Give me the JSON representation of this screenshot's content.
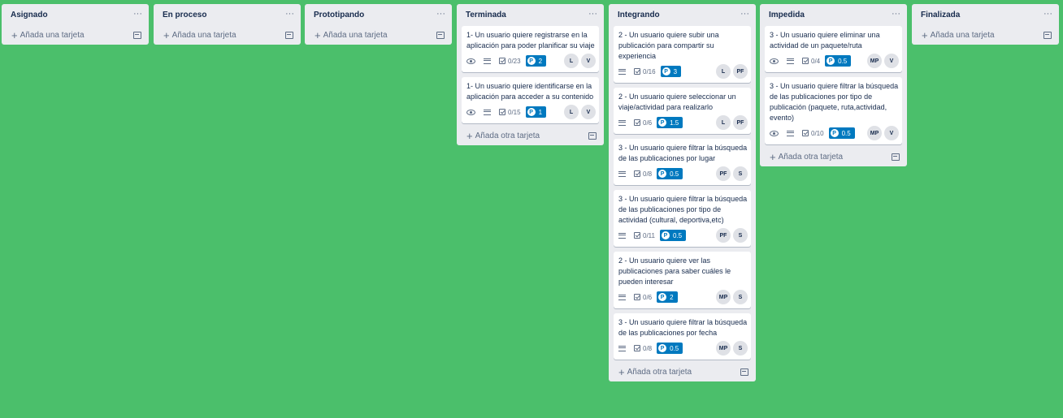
{
  "common": {
    "add_card": "Añada una tarjeta",
    "add_other_card": "Añada otra tarjeta",
    "menu": "···"
  },
  "colors": {
    "background": "#4bbf6b",
    "list": "#ebecf0",
    "points_badge": "#0079bf"
  },
  "lists": [
    {
      "title": "Asignado",
      "cards": []
    },
    {
      "title": "En proceso",
      "cards": []
    },
    {
      "title": "Prototipando",
      "cards": []
    },
    {
      "title": "Terminada",
      "cards": [
        {
          "text": "1- Un usuario quiere registrarse en la aplicación para poder planificar su viaje",
          "watch": true,
          "description": true,
          "checklist": "0/23",
          "points": "2",
          "members": [
            "L",
            "V"
          ]
        },
        {
          "text": "1- Un usuario quiere identificarse en la aplicación para acceder a su contenido",
          "watch": true,
          "description": true,
          "checklist": "0/15",
          "points": "1",
          "members": [
            "L",
            "V"
          ]
        }
      ]
    },
    {
      "title": "Integrando",
      "cards": [
        {
          "text": "2 - Un usuario quiere subir una publicación para compartir su experiencia",
          "watch": false,
          "description": true,
          "checklist": "0/16",
          "points": "3",
          "members": [
            "L",
            "PF"
          ]
        },
        {
          "text": "2 - Un usuario quiere seleccionar un viaje/actividad para realizarlo",
          "watch": false,
          "description": true,
          "checklist": "0/6",
          "points": "1.5",
          "members": [
            "L",
            "PF"
          ]
        },
        {
          "text": "3 - Un usuario quiere filtrar la búsqueda de las publicaciones por lugar",
          "watch": false,
          "description": true,
          "checklist": "0/8",
          "points": "0.5",
          "members": [
            "PF",
            "S"
          ]
        },
        {
          "text": "3 - Un usuario quiere filtrar la búsqueda de las publicaciones por tipo de actividad (cultural, deportiva,etc)",
          "watch": false,
          "description": true,
          "checklist": "0/11",
          "points": "0.5",
          "members": [
            "PF",
            "S"
          ]
        },
        {
          "text": "2 - Un usuario quiere ver las publicaciones para saber cuáles le pueden interesar",
          "watch": false,
          "description": true,
          "checklist": "0/6",
          "points": "2",
          "members": [
            "MP",
            "S"
          ]
        },
        {
          "text": "3 - Un usuario quiere filtrar la búsqueda de las publicaciones por fecha",
          "watch": false,
          "description": true,
          "checklist": "0/8",
          "points": "0.5",
          "members": [
            "MP",
            "S"
          ]
        }
      ]
    },
    {
      "title": "Impedida",
      "cards": [
        {
          "text": "3 - Un usuario quiere eliminar una actividad de un paquete/ruta",
          "watch": true,
          "description": true,
          "checklist": "0/4",
          "points": "0.5",
          "members": [
            "MP",
            "V"
          ]
        },
        {
          "text": "3 - Un usuario quiere filtrar la búsqueda de las publicaciones por tipo de publicación (paquete, ruta,actividad, evento)",
          "watch": true,
          "description": true,
          "checklist": "0/10",
          "points": "0.5",
          "members": [
            "MP",
            "V"
          ]
        }
      ]
    },
    {
      "title": "Finalizada",
      "cards": []
    }
  ]
}
